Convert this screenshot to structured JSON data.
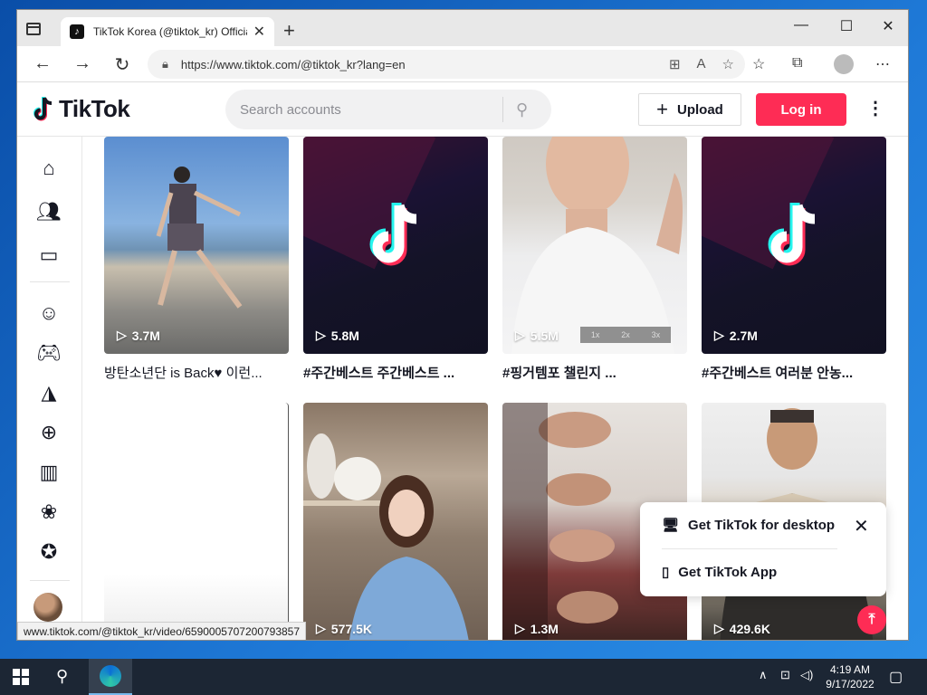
{
  "browser": {
    "tab_title": "TikTok Korea (@tiktok_kr) Officia",
    "tab_close": "✕",
    "new_tab": "+",
    "url": "https://www.tiktok.com/@tiktok_kr?lang=en",
    "status_url": "www.tiktok.com/@tiktok_kr/video/6590005707200793857"
  },
  "header": {
    "logo_text": "TikTok",
    "search_placeholder": "Search accounts",
    "upload_label": "Upload",
    "login_label": "Log in"
  },
  "sidebar": {
    "icons": [
      "home-icon",
      "following-icon",
      "live-icon",
      "comedy-icon",
      "gaming-icon",
      "food-icon",
      "sports-icon",
      "beauty-icon",
      "animals-icon",
      "achievement-icon"
    ]
  },
  "videos": [
    {
      "views": "3.7M",
      "caption": "방탄소년단 is Back♥ 이런..."
    },
    {
      "views": "5.8M",
      "caption": "#주간베스트 주간베스트 ..."
    },
    {
      "views": "5.5M",
      "caption": "#핑거템포 챌린지 ..."
    },
    {
      "views": "2.7M",
      "caption": "#주간베스트 여러분 안농..."
    },
    {
      "views": "",
      "caption": ""
    },
    {
      "views": "577.5K",
      "caption": ""
    },
    {
      "views": "1.3M",
      "caption": ""
    },
    {
      "views": "429.6K",
      "caption": ""
    }
  ],
  "speed_labels": [
    "1x",
    "2x",
    "3x"
  ],
  "popup": {
    "desktop_label": "Get TikTok for desktop",
    "app_label": "Get TikTok App"
  },
  "taskbar": {
    "time": "4:19 AM",
    "date": "9/17/2022"
  },
  "colors": {
    "brand": "#fe2c55",
    "text": "#161823",
    "taskbar": "#1c2634"
  }
}
